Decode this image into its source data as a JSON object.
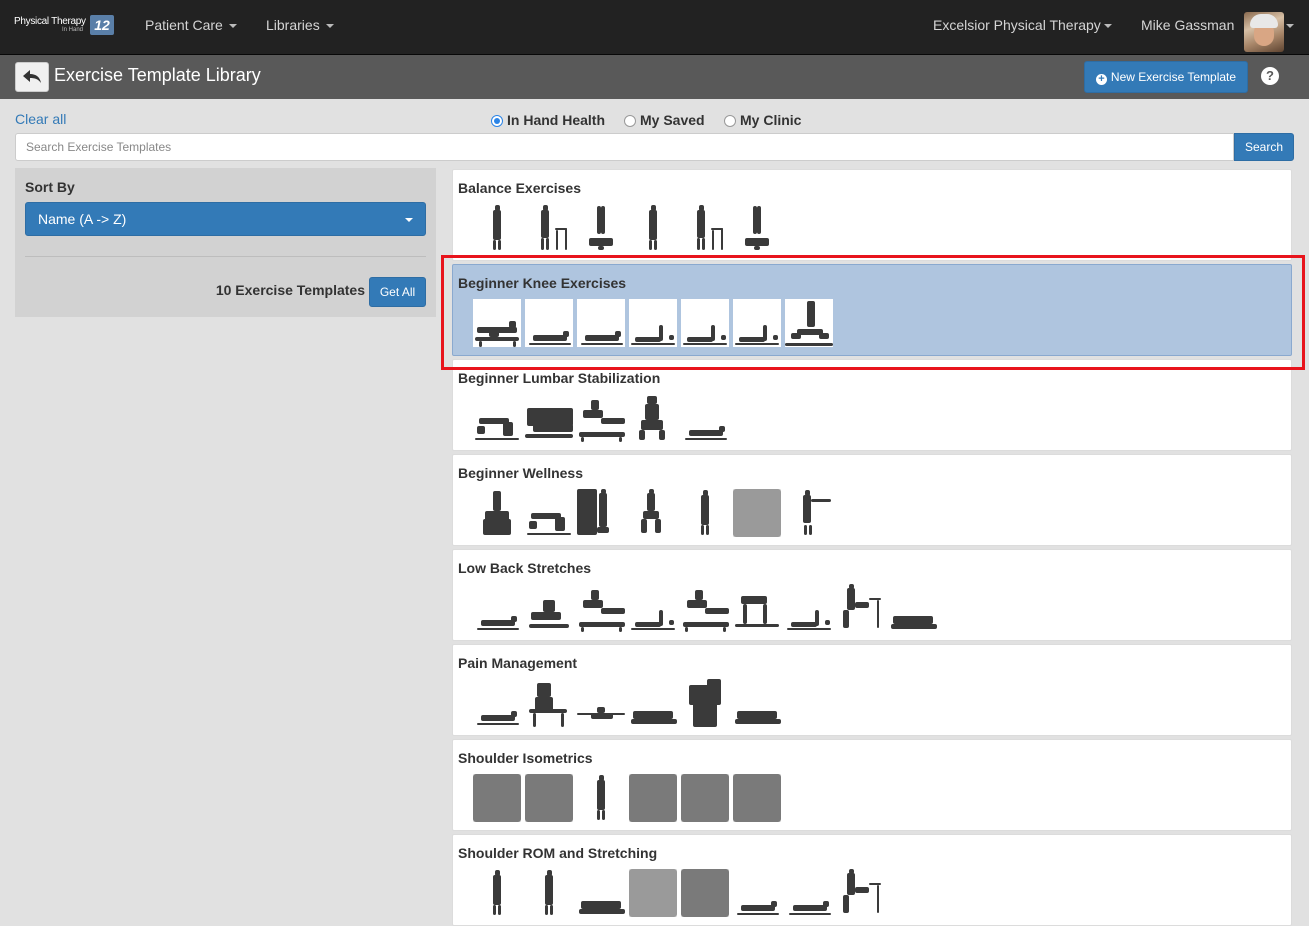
{
  "navbar": {
    "logo_text": "Physical Therapy",
    "logo_subtext": "In Hand",
    "logo_badge": "12",
    "menu": [
      {
        "label": "Patient Care"
      },
      {
        "label": "Libraries"
      }
    ],
    "clinic": "Excelsior Physical Therapy",
    "user": "Mike Gassman"
  },
  "header": {
    "title": "Exercise Template Library",
    "new_button": "New Exercise Template",
    "help": "?"
  },
  "filters": {
    "clear_all": "Clear all",
    "sources": [
      {
        "label": "In Hand Health",
        "selected": true
      },
      {
        "label": "My Saved",
        "selected": false
      },
      {
        "label": "My Clinic",
        "selected": false
      }
    ],
    "search": {
      "placeholder": "Search Exercise Templates",
      "value": "",
      "button": "Search"
    }
  },
  "sidebar": {
    "sort_label": "Sort By",
    "sort_value": "Name (A -> Z)",
    "count_text": "10 Exercise Templates",
    "get_all": "Get All"
  },
  "templates": [
    {
      "name": "Balance Exercises",
      "thumbs": [
        "standing",
        "standing-chair",
        "standing-bosu",
        "standing",
        "standing-chair",
        "standing-bosu"
      ],
      "selected": false
    },
    {
      "name": "Beginner Knee Exercises",
      "thumbs": [
        "supine-bolster",
        "supine",
        "supine",
        "supine-leg-raise",
        "supine-leg-raise",
        "supine-leg-raise",
        "seated-band"
      ],
      "selected": true
    },
    {
      "name": "Beginner Lumbar Stabilization",
      "thumbs": [
        "bridge",
        "lying-side",
        "table-stretch",
        "seated",
        "supine"
      ],
      "selected": false
    },
    {
      "name": "Beginner Wellness",
      "thumbs": [
        "seated-ball",
        "bridge",
        "wall-stretch",
        "squat",
        "standing",
        "arms-up",
        "arms-forward"
      ],
      "selected": false
    },
    {
      "name": "Low Back Stretches",
      "thumbs": [
        "supine",
        "knee-to-chest",
        "table-stretch",
        "supine-leg-raise",
        "table-stretch",
        "quadruped",
        "supine-leg-raise",
        "chair-stretch",
        "prone"
      ],
      "selected": false
    },
    {
      "name": "Pain Management",
      "thumbs": [
        "supine",
        "seated-desk",
        "supine-arms",
        "prone",
        "neck-stretch",
        "prone"
      ],
      "selected": false
    },
    {
      "name": "Shoulder Isometrics",
      "thumbs": [
        "arm-closeup",
        "arm-closeup",
        "standing",
        "arm-closeup",
        "arm-closeup",
        "arm-closeup"
      ],
      "selected": false
    },
    {
      "name": "Shoulder ROM and Stretching",
      "thumbs": [
        "standing",
        "standing",
        "prone",
        "arms-up",
        "arm-closeup",
        "supine",
        "supine",
        "chair-stretch"
      ],
      "selected": false
    }
  ]
}
